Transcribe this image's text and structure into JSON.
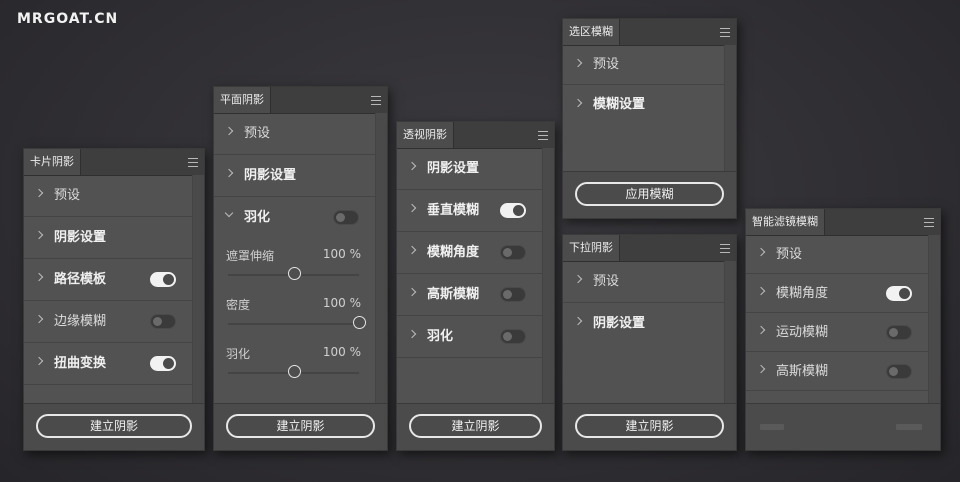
{
  "logo": "MRGOAT.CN",
  "panels": {
    "card": {
      "tab": "卡片阴影",
      "rows": [
        {
          "label": "预设"
        },
        {
          "label": "阴影设置"
        },
        {
          "label": "路径模板",
          "toggle": "on"
        },
        {
          "label": "边缘模糊",
          "toggle": "off"
        },
        {
          "label": "扭曲变换",
          "toggle": "on"
        }
      ],
      "button": "建立阴影"
    },
    "flat": {
      "tab": "平面阴影",
      "rows": [
        {
          "label": "预设"
        },
        {
          "label": "阴影设置"
        },
        {
          "label": "羽化",
          "toggle": "off",
          "expanded": true
        }
      ],
      "sliders": [
        {
          "label": "遮罩伸缩",
          "value": "100 %",
          "position": 0.5
        },
        {
          "label": "密度",
          "value": "100 %",
          "position": 1.0
        },
        {
          "label": "羽化",
          "value": "100 %",
          "position": 0.5
        }
      ],
      "button": "建立阴影"
    },
    "perspective": {
      "tab": "透视阴影",
      "rows": [
        {
          "label": "阴影设置"
        },
        {
          "label": "垂直模糊",
          "toggle": "on"
        },
        {
          "label": "模糊角度",
          "toggle": "off"
        },
        {
          "label": "高斯模糊",
          "toggle": "off"
        },
        {
          "label": "羽化",
          "toggle": "off"
        }
      ],
      "button": "建立阴影"
    },
    "selection": {
      "tab": "选区模糊",
      "rows": [
        {
          "label": "预设"
        },
        {
          "label": "模糊设置"
        }
      ],
      "button": "应用模糊"
    },
    "dropdown": {
      "tab": "下拉阴影",
      "rows": [
        {
          "label": "预设"
        },
        {
          "label": "阴影设置"
        }
      ],
      "button": "建立阴影"
    },
    "smart": {
      "tab": "智能滤镜模糊",
      "rows": [
        {
          "label": "预设"
        },
        {
          "label": "模糊角度",
          "toggle": "on"
        },
        {
          "label": "运动模糊",
          "toggle": "off"
        },
        {
          "label": "高斯模糊",
          "toggle": "off"
        }
      ]
    }
  }
}
